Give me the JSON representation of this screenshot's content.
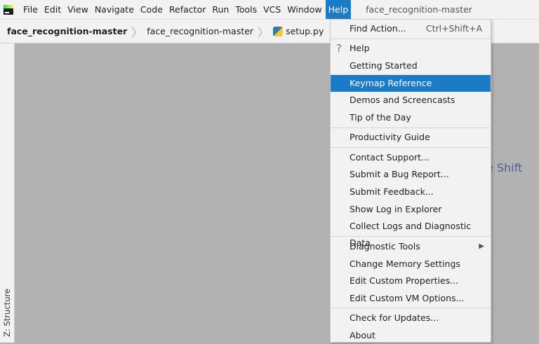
{
  "menubar": {
    "items": [
      "File",
      "Edit",
      "View",
      "Navigate",
      "Code",
      "Refactor",
      "Run",
      "Tools",
      "VCS",
      "Window",
      "Help"
    ],
    "active": "Help",
    "window_title": "face_recognition-master"
  },
  "breadcrumb": [
    "face_recognition-master",
    "face_recognition-master",
    "setup.py"
  ],
  "left_tool": "Z: Structure",
  "hint_text": "e Shift",
  "help_menu": {
    "find_action": "Find Action...",
    "find_action_shortcut": "Ctrl+Shift+A",
    "items": [
      "Help",
      "Getting Started",
      "Keymap Reference",
      "Demos and Screencasts",
      "Tip of the Day",
      "Productivity Guide",
      "Contact Support...",
      "Submit a Bug Report...",
      "Submit Feedback...",
      "Show Log in Explorer",
      "Collect Logs and Diagnostic Data",
      "Diagnostic Tools",
      "Change Memory Settings",
      "Edit Custom Properties...",
      "Edit Custom VM Options...",
      "Check for Updates...",
      "About"
    ],
    "selected": "Keymap Reference"
  },
  "colors": {
    "accent": "#1c7bc7"
  }
}
